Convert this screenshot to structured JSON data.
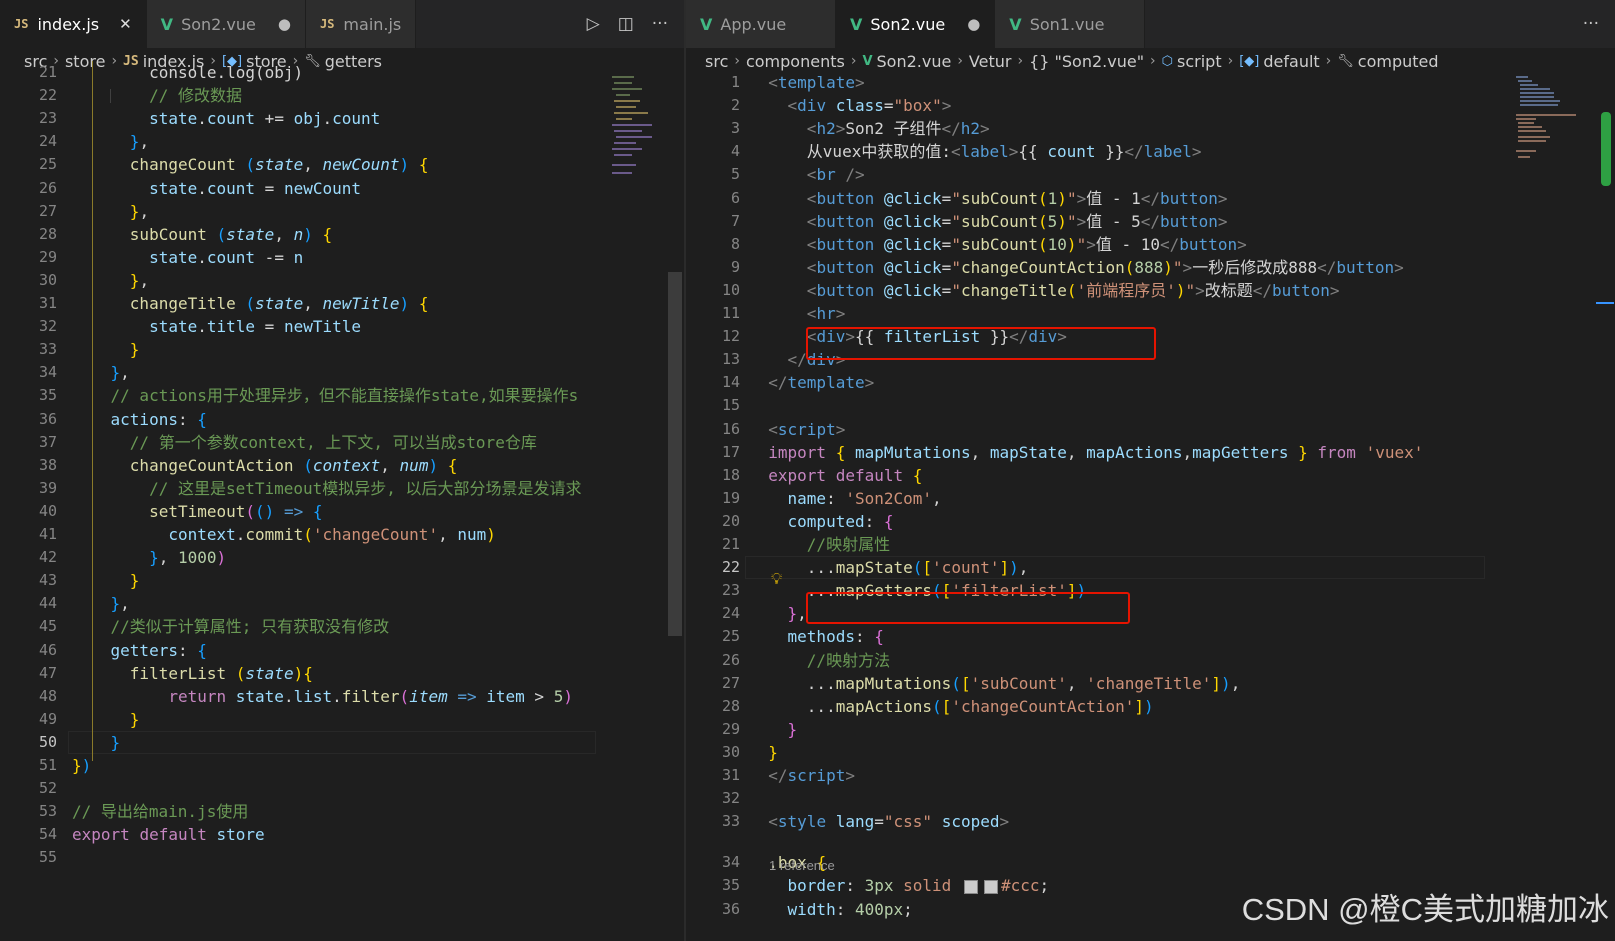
{
  "left": {
    "tabs": [
      {
        "icon": "JS",
        "label": "index.js",
        "active": true,
        "close": "✕"
      },
      {
        "icon": "V",
        "label": "Son2.vue",
        "active": false,
        "dirty": "●"
      },
      {
        "icon": "JS",
        "label": "main.js",
        "active": false
      }
    ],
    "breadcrumb": [
      "src",
      "store",
      "index.js",
      "store",
      "getters"
    ],
    "lines": [
      {
        "n": "21",
        "html": "        <span class=\"c-w\">console.log(obj)</span>"
      },
      {
        "n": "22",
        "html": "        <span class=\"c-c\">// 修改数据</span>"
      },
      {
        "n": "23",
        "html": "        <span class=\"c-p\">state</span><span class=\"c-w\">.</span><span class=\"c-p\">count</span><span class=\"c-w\"> += </span><span class=\"c-p\">obj</span><span class=\"c-w\">.</span><span class=\"c-p\">count</span>"
      },
      {
        "n": "24",
        "html": "      <span class=\"c-b3\">}</span><span class=\"c-w\">,</span>"
      },
      {
        "n": "25",
        "html": "      <span class=\"c-f\">changeCount</span><span class=\"c-w\"> </span><span class=\"c-b3\">(</span><span class=\"c-i\">state</span><span class=\"c-w\">, </span><span class=\"c-i\">newCount</span><span class=\"c-b3\">)</span><span class=\"c-w\"> </span><span class=\"c-b1\">{</span>"
      },
      {
        "n": "26",
        "html": "        <span class=\"c-p\">state</span><span class=\"c-w\">.</span><span class=\"c-p\">count</span><span class=\"c-w\"> = </span><span class=\"c-p\">newCount</span>"
      },
      {
        "n": "27",
        "html": "      <span class=\"c-b1\">}</span><span class=\"c-w\">,</span>"
      },
      {
        "n": "28",
        "html": "      <span class=\"c-f\">subCount</span><span class=\"c-w\"> </span><span class=\"c-b3\">(</span><span class=\"c-i\">state</span><span class=\"c-w\">, </span><span class=\"c-i\">n</span><span class=\"c-b3\">)</span><span class=\"c-w\"> </span><span class=\"c-b1\">{</span>"
      },
      {
        "n": "29",
        "html": "        <span class=\"c-p\">state</span><span class=\"c-w\">.</span><span class=\"c-p\">count</span><span class=\"c-w\"> -= </span><span class=\"c-p\">n</span>"
      },
      {
        "n": "30",
        "html": "      <span class=\"c-b1\">}</span><span class=\"c-w\">,</span>"
      },
      {
        "n": "31",
        "html": "      <span class=\"c-f\">changeTitle</span><span class=\"c-w\"> </span><span class=\"c-b3\">(</span><span class=\"c-i\">state</span><span class=\"c-w\">, </span><span class=\"c-i\">newTitle</span><span class=\"c-b3\">)</span><span class=\"c-w\"> </span><span class=\"c-b1\">{</span>"
      },
      {
        "n": "32",
        "html": "        <span class=\"c-p\">state</span><span class=\"c-w\">.</span><span class=\"c-p\">title</span><span class=\"c-w\"> = </span><span class=\"c-p\">newTitle</span>"
      },
      {
        "n": "33",
        "html": "      <span class=\"c-b1\">}</span>"
      },
      {
        "n": "34",
        "html": "    <span class=\"c-b3\">}</span><span class=\"c-w\">,</span>"
      },
      {
        "n": "35",
        "html": "    <span class=\"c-c\">// actions用于处理异步，但不能直接操作state,如果要操作s</span>"
      },
      {
        "n": "36",
        "html": "    <span class=\"c-p\">actions</span><span class=\"c-w\">: </span><span class=\"c-b3\">{</span>"
      },
      {
        "n": "37",
        "html": "      <span class=\"c-c\">// 第一个参数context, 上下文, 可以当成store仓库</span>"
      },
      {
        "n": "38",
        "html": "      <span class=\"c-f\">changeCountAction</span><span class=\"c-w\"> </span><span class=\"c-b3\">(</span><span class=\"c-i\">context</span><span class=\"c-w\">, </span><span class=\"c-i\">num</span><span class=\"c-b3\">)</span><span class=\"c-w\"> </span><span class=\"c-b1\">{</span>"
      },
      {
        "n": "39",
        "html": "        <span class=\"c-c\">// 这里是setTimeout模拟异步, 以后大部分场景是发请求</span>"
      },
      {
        "n": "40",
        "html": "        <span class=\"c-f\">setTimeout</span><span class=\"c-b2\">(</span><span class=\"c-b3\">()</span><span class=\"c-w\"> </span><span class=\"c-k\">=&gt;</span><span class=\"c-w\"> </span><span class=\"c-b3\">{</span>"
      },
      {
        "n": "41",
        "html": "          <span class=\"c-p\">context</span><span class=\"c-w\">.</span><span class=\"c-f\">commit</span><span class=\"c-b1\">(</span><span class=\"c-s\">'changeCount'</span><span class=\"c-w\">, </span><span class=\"c-p\">num</span><span class=\"c-b1\">)</span>"
      },
      {
        "n": "42",
        "html": "        <span class=\"c-b3\">}</span><span class=\"c-w\">, </span><span class=\"c-n\">1000</span><span class=\"c-b2\">)</span>"
      },
      {
        "n": "43",
        "html": "      <span class=\"c-b1\">}</span>"
      },
      {
        "n": "44",
        "html": "    <span class=\"c-b3\">}</span><span class=\"c-w\">,</span>"
      },
      {
        "n": "45",
        "html": "    <span class=\"c-c\">//类似于计算属性; 只有获取没有修改</span>"
      },
      {
        "n": "46",
        "html": "    <span class=\"c-p\">getters</span><span class=\"c-w\">: </span><span class=\"c-b3\">{</span>"
      },
      {
        "n": "47",
        "html": "      <span class=\"c-f\">filterList</span><span class=\"c-w\"> </span><span class=\"c-b1\">(</span><span class=\"c-i\">state</span><span class=\"c-b1\">)</span><span class=\"c-b1\">{</span>"
      },
      {
        "n": "48",
        "html": "          <span class=\"c-kc\">return</span><span class=\"c-w\"> </span><span class=\"c-p\">state</span><span class=\"c-w\">.</span><span class=\"c-p\">list</span><span class=\"c-w\">.</span><span class=\"c-f\">filter</span><span class=\"c-b2\">(</span><span class=\"c-i\">item</span><span class=\"c-w\"> </span><span class=\"c-k\">=&gt;</span><span class=\"c-w\"> </span><span class=\"c-p\">item</span><span class=\"c-w\"> &gt; </span><span class=\"c-n\">5</span><span class=\"c-b2\">)</span>"
      },
      {
        "n": "49",
        "html": "      <span class=\"c-b1\">}</span>"
      },
      {
        "n": "50",
        "html": "    <span class=\"c-b3\">}</span>",
        "current": true
      },
      {
        "n": "51",
        "html": "<span class=\"c-b1\">}</span><span class=\"c-b3\">)</span>"
      },
      {
        "n": "52",
        "html": ""
      },
      {
        "n": "53",
        "html": "<span class=\"c-c\">// 导出给main.js使用</span>"
      },
      {
        "n": "54",
        "html": "<span class=\"c-kc\">export</span><span class=\"c-w\"> </span><span class=\"c-kc\">default</span><span class=\"c-w\"> </span><span class=\"c-p\">store</span>"
      },
      {
        "n": "55",
        "html": ""
      }
    ]
  },
  "right": {
    "tabs": [
      {
        "icon": "V",
        "label": "App.vue",
        "active": false
      },
      {
        "icon": "V",
        "label": "Son2.vue",
        "active": true,
        "dirty": "●"
      },
      {
        "icon": "V",
        "label": "Son1.vue",
        "active": false
      }
    ],
    "breadcrumb": [
      "src",
      "components",
      "Son2.vue",
      "Vetur",
      "{} \"Son2.vue\"",
      "script",
      "default",
      "computed"
    ],
    "reference": "1 reference",
    "lines": [
      {
        "n": "1",
        "html": "  <span class=\"c-tag\">&lt;</span><span class=\"c-t\">template</span><span class=\"c-tag\">&gt;</span>"
      },
      {
        "n": "2",
        "html": "    <span class=\"c-tag\">&lt;</span><span class=\"c-t\">div</span><span class=\"c-w\"> </span><span class=\"c-a\">class</span><span class=\"c-w\">=</span><span class=\"c-s\">\"box\"</span><span class=\"c-tag\">&gt;</span>"
      },
      {
        "n": "3",
        "html": "      <span class=\"c-tag\">&lt;</span><span class=\"c-t\">h2</span><span class=\"c-tag\">&gt;</span><span class=\"c-w\">Son2 子组件</span><span class=\"c-tag\">&lt;/</span><span class=\"c-t\">h2</span><span class=\"c-tag\">&gt;</span>"
      },
      {
        "n": "4",
        "html": "      <span class=\"c-w\">从vuex中获取的值:</span><span class=\"c-tag\">&lt;</span><span class=\"c-t\">label</span><span class=\"c-tag\">&gt;</span><span class=\"c-w\">{{ </span><span class=\"c-p\">count</span><span class=\"c-w\"> }}</span><span class=\"c-tag\">&lt;/</span><span class=\"c-t\">label</span><span class=\"c-tag\">&gt;</span>"
      },
      {
        "n": "5",
        "html": "      <span class=\"c-tag\">&lt;</span><span class=\"c-t\">br</span><span class=\"c-tag\"> /&gt;</span>"
      },
      {
        "n": "6",
        "html": "      <span class=\"c-tag\">&lt;</span><span class=\"c-t\">button</span><span class=\"c-w\"> </span><span class=\"c-a\">@click</span><span class=\"c-w\">=</span><span class=\"c-s\">\"</span><span class=\"c-f\">subCount</span><span class=\"c-b1\">(</span><span class=\"c-n\">1</span><span class=\"c-b1\">)</span><span class=\"c-s\">\"</span><span class=\"c-tag\">&gt;</span><span class=\"c-w\">值 - 1</span><span class=\"c-tag\">&lt;/</span><span class=\"c-t\">button</span><span class=\"c-tag\">&gt;</span>"
      },
      {
        "n": "7",
        "html": "      <span class=\"c-tag\">&lt;</span><span class=\"c-t\">button</span><span class=\"c-w\"> </span><span class=\"c-a\">@click</span><span class=\"c-w\">=</span><span class=\"c-s\">\"</span><span class=\"c-f\">subCount</span><span class=\"c-b1\">(</span><span class=\"c-n\">5</span><span class=\"c-b1\">)</span><span class=\"c-s\">\"</span><span class=\"c-tag\">&gt;</span><span class=\"c-w\">值 - 5</span><span class=\"c-tag\">&lt;/</span><span class=\"c-t\">button</span><span class=\"c-tag\">&gt;</span>"
      },
      {
        "n": "8",
        "html": "      <span class=\"c-tag\">&lt;</span><span class=\"c-t\">button</span><span class=\"c-w\"> </span><span class=\"c-a\">@click</span><span class=\"c-w\">=</span><span class=\"c-s\">\"</span><span class=\"c-f\">subCount</span><span class=\"c-b1\">(</span><span class=\"c-n\">10</span><span class=\"c-b1\">)</span><span class=\"c-s\">\"</span><span class=\"c-tag\">&gt;</span><span class=\"c-w\">值 - 10</span><span class=\"c-tag\">&lt;/</span><span class=\"c-t\">button</span><span class=\"c-tag\">&gt;</span>"
      },
      {
        "n": "9",
        "html": "      <span class=\"c-tag\">&lt;</span><span class=\"c-t\">button</span><span class=\"c-w\"> </span><span class=\"c-a\">@click</span><span class=\"c-w\">=</span><span class=\"c-s\">\"</span><span class=\"c-f\">changeCountAction</span><span class=\"c-b1\">(</span><span class=\"c-n\">888</span><span class=\"c-b1\">)</span><span class=\"c-s\">\"</span><span class=\"c-tag\">&gt;</span><span class=\"c-w\">一秒后修改成888</span><span class=\"c-tag\">&lt;/</span><span class=\"c-t\">button</span><span class=\"c-tag\">&gt;</span>"
      },
      {
        "n": "10",
        "html": "      <span class=\"c-tag\">&lt;</span><span class=\"c-t\">button</span><span class=\"c-w\"> </span><span class=\"c-a\">@click</span><span class=\"c-w\">=</span><span class=\"c-s\">\"</span><span class=\"c-f\">changeTitle</span><span class=\"c-b1\">(</span><span class=\"c-s\">'前端程序员'</span><span class=\"c-b1\">)</span><span class=\"c-s\">\"</span><span class=\"c-tag\">&gt;</span><span class=\"c-w\">改标题</span><span class=\"c-tag\">&lt;/</span><span class=\"c-t\">button</span><span class=\"c-tag\">&gt;</span>"
      },
      {
        "n": "11",
        "html": "      <span class=\"c-tag\">&lt;</span><span class=\"c-t\">hr</span><span class=\"c-tag\">&gt;</span>"
      },
      {
        "n": "12",
        "html": "      <span class=\"c-tag\">&lt;</span><span class=\"c-t\">div</span><span class=\"c-tag\">&gt;</span><span class=\"c-w\">{{ </span><span class=\"c-p\">filterList</span><span class=\"c-w\"> }}</span><span class=\"c-tag\">&lt;/</span><span class=\"c-t\">div</span><span class=\"c-tag\">&gt;</span>"
      },
      {
        "n": "13",
        "html": "    <span class=\"c-tag\">&lt;/</span><span class=\"c-t\">div</span><span class=\"c-tag\">&gt;</span>"
      },
      {
        "n": "14",
        "html": "  <span class=\"c-tag\">&lt;/</span><span class=\"c-t\">template</span><span class=\"c-tag\">&gt;</span>"
      },
      {
        "n": "15",
        "html": ""
      },
      {
        "n": "16",
        "html": "  <span class=\"c-tag\">&lt;</span><span class=\"c-t\">script</span><span class=\"c-tag\">&gt;</span>"
      },
      {
        "n": "17",
        "html": "  <span class=\"c-kc\">import</span><span class=\"c-w\"> </span><span class=\"c-b1\">{</span><span class=\"c-w\"> </span><span class=\"c-p\">mapMutations</span><span class=\"c-w\">, </span><span class=\"c-p\">mapState</span><span class=\"c-w\">, </span><span class=\"c-p\">mapActions</span><span class=\"c-w\">,</span><span class=\"c-p\">mapGetters</span><span class=\"c-w\"> </span><span class=\"c-b1\">}</span><span class=\"c-w\"> </span><span class=\"c-kc\">from</span><span class=\"c-w\"> </span><span class=\"c-s\">'vuex'</span>"
      },
      {
        "n": "18",
        "html": "  <span class=\"c-kc\">export</span><span class=\"c-w\"> </span><span class=\"c-kc\">default</span><span class=\"c-w\"> </span><span class=\"c-b1\">{</span>"
      },
      {
        "n": "19",
        "html": "    <span class=\"c-p\">name</span><span class=\"c-w\">: </span><span class=\"c-s\">'Son2Com'</span><span class=\"c-w\">,</span>"
      },
      {
        "n": "20",
        "html": "    <span class=\"c-p\">computed</span><span class=\"c-w\">: </span><span class=\"c-b2\">{</span>"
      },
      {
        "n": "21",
        "html": "      <span class=\"c-c\">//映射属性</span>"
      },
      {
        "n": "22",
        "html": "      <span class=\"c-w\">...</span><span class=\"c-f\">mapState</span><span class=\"c-b3\">(</span><span class=\"c-b1\">[</span><span class=\"c-s\">'count'</span><span class=\"c-b1\">]</span><span class=\"c-b3\">)</span><span class=\"c-w\">,</span>",
        "current": true
      },
      {
        "n": "23",
        "html": "      <span class=\"c-w\">...</span><span class=\"c-f\">mapGetters</span><span class=\"c-b3\">(</span><span class=\"c-b1\">[</span><span class=\"c-s\">'filterList'</span><span class=\"c-b1\">]</span><span class=\"c-b3\">)</span>"
      },
      {
        "n": "24",
        "html": "    <span class=\"c-b2\">}</span><span class=\"c-w\">,</span>"
      },
      {
        "n": "25",
        "html": "    <span class=\"c-p\">methods</span><span class=\"c-w\">: </span><span class=\"c-b2\">{</span>"
      },
      {
        "n": "26",
        "html": "      <span class=\"c-c\">//映射方法</span>"
      },
      {
        "n": "27",
        "html": "      <span class=\"c-w\">...</span><span class=\"c-f\">mapMutations</span><span class=\"c-b3\">(</span><span class=\"c-b1\">[</span><span class=\"c-s\">'subCount'</span><span class=\"c-w\">, </span><span class=\"c-s\">'changeTitle'</span><span class=\"c-b1\">]</span><span class=\"c-b3\">)</span><span class=\"c-w\">,</span>"
      },
      {
        "n": "28",
        "html": "      <span class=\"c-w\">...</span><span class=\"c-f\">mapActions</span><span class=\"c-b3\">(</span><span class=\"c-b1\">[</span><span class=\"c-s\">'changeCountAction'</span><span class=\"c-b1\">]</span><span class=\"c-b3\">)</span>"
      },
      {
        "n": "29",
        "html": "    <span class=\"c-b2\">}</span>"
      },
      {
        "n": "30",
        "html": "  <span class=\"c-b1\">}</span>"
      },
      {
        "n": "31",
        "html": "  <span class=\"c-tag\">&lt;/</span><span class=\"c-t\">script</span><span class=\"c-tag\">&gt;</span>"
      },
      {
        "n": "32",
        "html": ""
      },
      {
        "n": "33",
        "html": "  <span class=\"c-tag\">&lt;</span><span class=\"c-t\">style</span><span class=\"c-w\"> </span><span class=\"c-a\">lang</span><span class=\"c-w\">=</span><span class=\"c-s\">\"css\"</span><span class=\"c-w\"> </span><span class=\"c-a\">scoped</span><span class=\"c-tag\">&gt;</span>"
      },
      {
        "n": "34",
        "html": "  <span class=\"c-f\">.box</span><span class=\"c-w\"> </span><span class=\"c-b1\">{</span>",
        "afterRef": true
      },
      {
        "n": "35",
        "html": "    <span class=\"c-p\">border</span><span class=\"c-w\">: </span><span class=\"c-n\">3px</span><span class=\"c-w\"> </span><span class=\"c-s\">solid</span><span class=\"c-w\"> </span><span class=\"swatch\"></span><span class=\"swatch\"></span><span class=\"c-s\">#ccc</span><span class=\"c-w\">;</span>",
        "afterRef": true
      },
      {
        "n": "36",
        "html": "    <span class=\"c-p\">width</span><span class=\"c-w\">: </span><span class=\"c-n\">400px</span><span class=\"c-w\">;</span>",
        "afterRef": true
      }
    ]
  },
  "watermark": "CSDN @橙C美式加糖加冰",
  "colors": {
    "redbox": "#e51400",
    "bg": "#1e1e1e",
    "vue_green": "#41b883"
  }
}
